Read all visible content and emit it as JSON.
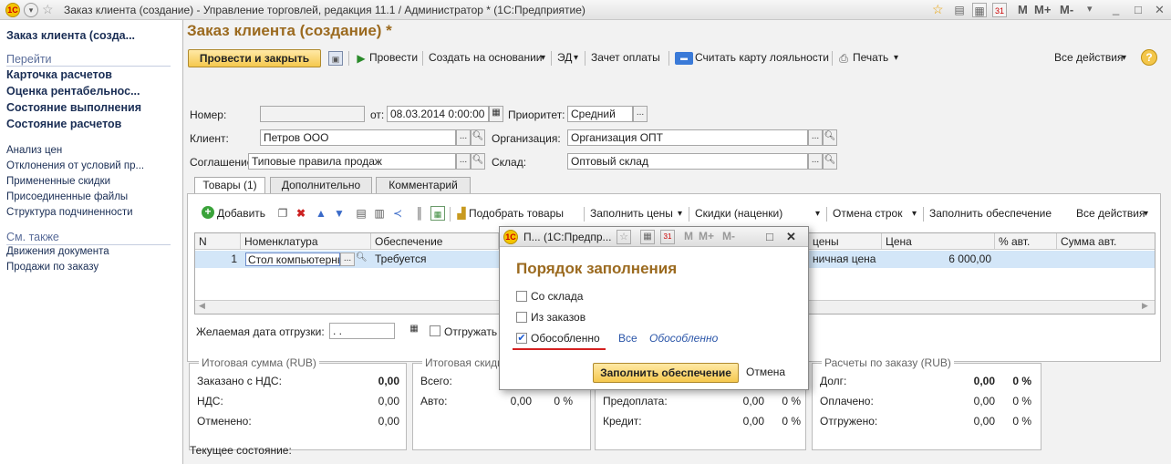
{
  "window": {
    "title": "Заказ клиента (создание) - Управление торговлей, редакция 11.1 / Администратор * (1С:Предприятие)",
    "m_buttons": [
      "M",
      "M+",
      "M-"
    ]
  },
  "sidebar": {
    "top_item": "Заказ клиента (созда...",
    "goto_heading": "Перейти",
    "goto_items": [
      "Карточка расчетов",
      "Оценка рентабельнос...",
      "Состояние выполнения",
      "Состояние расчетов"
    ],
    "more_items": [
      "Анализ цен",
      "Отклонения от условий пр...",
      "Примененные скидки",
      "Присоединенные файлы",
      "Структура подчиненности"
    ],
    "see_also_heading": "См. также",
    "see_also_items": [
      "Движения документа",
      "Продажи по заказу"
    ]
  },
  "form": {
    "title": "Заказ клиента (создание) *",
    "toolbar": {
      "post_close": "Провести и закрыть",
      "post": "Провести",
      "create_based": "Создать на основании",
      "ed": "ЭД",
      "payment_offset": "Зачет оплаты",
      "loyalty_card": "Считать карту лояльности",
      "print": "Печать",
      "all_actions": "Все действия"
    },
    "fields": {
      "number_label": "Номер:",
      "number_value": "",
      "date_label": "от:",
      "date_value": "08.03.2014 0:00:00",
      "priority_label": "Приоритет:",
      "priority_value": "Средний",
      "client_label": "Клиент:",
      "client_value": "Петров ООО",
      "org_label": "Организация:",
      "org_value": "Организация ОПТ",
      "agreement_label": "Соглашение:",
      "agreement_value": "Типовые правила продаж",
      "warehouse_label": "Склад:",
      "warehouse_value": "Оптовый склад"
    },
    "tabs": [
      "Товары (1)",
      "Дополнительно",
      "Комментарий"
    ],
    "goods_toolbar": {
      "add": "Добавить",
      "pick_goods": "Подобрать товары",
      "fill_prices": "Заполнить цены",
      "discounts": "Скидки (наценки)",
      "cancel_rows": "Отмена строк",
      "fill_supply": "Заполнить обеспечение",
      "all_actions": "Все действия"
    },
    "table": {
      "columns": [
        "N",
        "Номенклатура",
        "Обеспечение",
        "цены",
        "Цена",
        "% авт.",
        "Сумма авт."
      ],
      "rows": [
        {
          "n": "1",
          "item": "Стол компьютерны",
          "supply": "Требуется",
          "price_type": "ничная цена",
          "price": "6 000,00"
        }
      ]
    },
    "ship_date_label": "Желаемая дата отгрузки:",
    "ship_date_value": ". .",
    "ship_checkbox_label": "Отгружать",
    "totals": {
      "heading": "Итоговая сумма (RUB)",
      "ordered_label": "Заказано с НДС:",
      "ordered_value": "0,00",
      "vat_label": "НДС:",
      "vat_value": "0,00",
      "cancelled_label": "Отменено:",
      "cancelled_value": "0,00"
    },
    "discounts_box": {
      "heading": "Итоговая скидк",
      "total_label": "Всего:",
      "auto_label": "Авто:",
      "auto_value": "0,00",
      "auto_pct": "0 %"
    },
    "payment_box": {
      "prepay_label": "Предоплата:",
      "prepay_value": "0,00",
      "prepay_pct": "0 %",
      "credit_label": "Кредит:",
      "credit_value": "0,00",
      "credit_pct": "0 %"
    },
    "settlements": {
      "heading": "Расчеты по заказу (RUB)",
      "debt_label": "Долг:",
      "debt_value": "0,00",
      "debt_pct": "0 %",
      "paid_label": "Оплачено:",
      "paid_value": "0,00",
      "paid_pct": "0 %",
      "shipped_label": "Отгружено:",
      "shipped_value": "0,00",
      "shipped_pct": "0 %"
    },
    "current_state_label": "Текущее состояние:"
  },
  "dialog": {
    "title": "П... (1С:Предпр...",
    "m_buttons": [
      "M",
      "M+",
      "M-"
    ],
    "heading": "Порядок заполнения",
    "options": [
      {
        "label": "Со склада",
        "checked": false
      },
      {
        "label": "Из заказов",
        "checked": false
      },
      {
        "label": "Обособленно",
        "checked": true
      }
    ],
    "link_all": "Все",
    "link_separate": "Обособленно",
    "fill_button": "Заполнить обеспечение",
    "cancel_button": "Отмена"
  }
}
